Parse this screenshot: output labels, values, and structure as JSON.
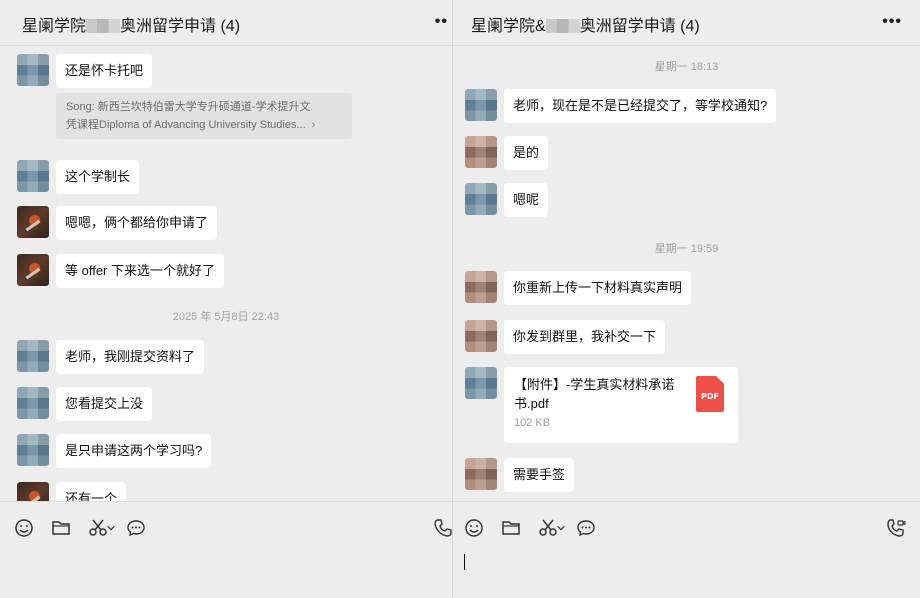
{
  "left_chat": {
    "title_part1": "星阑学院",
    "title_part2": "奥洲留学申请 (4)",
    "more": "••",
    "messages": {
      "m1": "还是怀卡托吧",
      "quote_line1": "Song: 新西兰坎特伯雷大学专升硕通道-学术提升文",
      "quote_line2": "凭课程Diploma of Advancing University Studies...",
      "quote_arrow": "›",
      "m2": "这个学制长",
      "m3": "嗯嗯，俩个都给你申请了",
      "m4": "等 offer 下来选一个就好了",
      "time1": "2025 年 5月8日 22:43",
      "m5": "老师，我刚提交资料了",
      "m6": "您看提交上没",
      "m7": "是只申请这两个学习吗?",
      "m8": "还有一个"
    }
  },
  "right_chat": {
    "title_part1": "星阑学院&",
    "title_part2": "奥洲留学申请 (4)",
    "more": "•••",
    "messages": {
      "time1": "星期一 18:13",
      "m1": "老师，现在是不是已经提交了，等学校通知?",
      "m2": "是的",
      "m3": "嗯呢",
      "time2": "星期一 19:59",
      "m4": "你重新上传一下材料真实声明",
      "m5": "你发到群里，我补交一下",
      "file_name": "【附件】-学生真实材料承诺书.pdf",
      "file_size": "102 KB",
      "file_type": "PDF",
      "m6": "需要手签"
    }
  },
  "toolbar": {
    "icons": [
      "emoji-icon",
      "folder-icon",
      "scissors-icon",
      "chevron-down-icon",
      "chat-bubble-icon",
      "phone-icon",
      "video-call-icon"
    ]
  },
  "colors": {
    "background": "#ededed",
    "bubble": "#ffffff",
    "pdf": "#f0504a",
    "timestamp": "#a0a0a0"
  }
}
